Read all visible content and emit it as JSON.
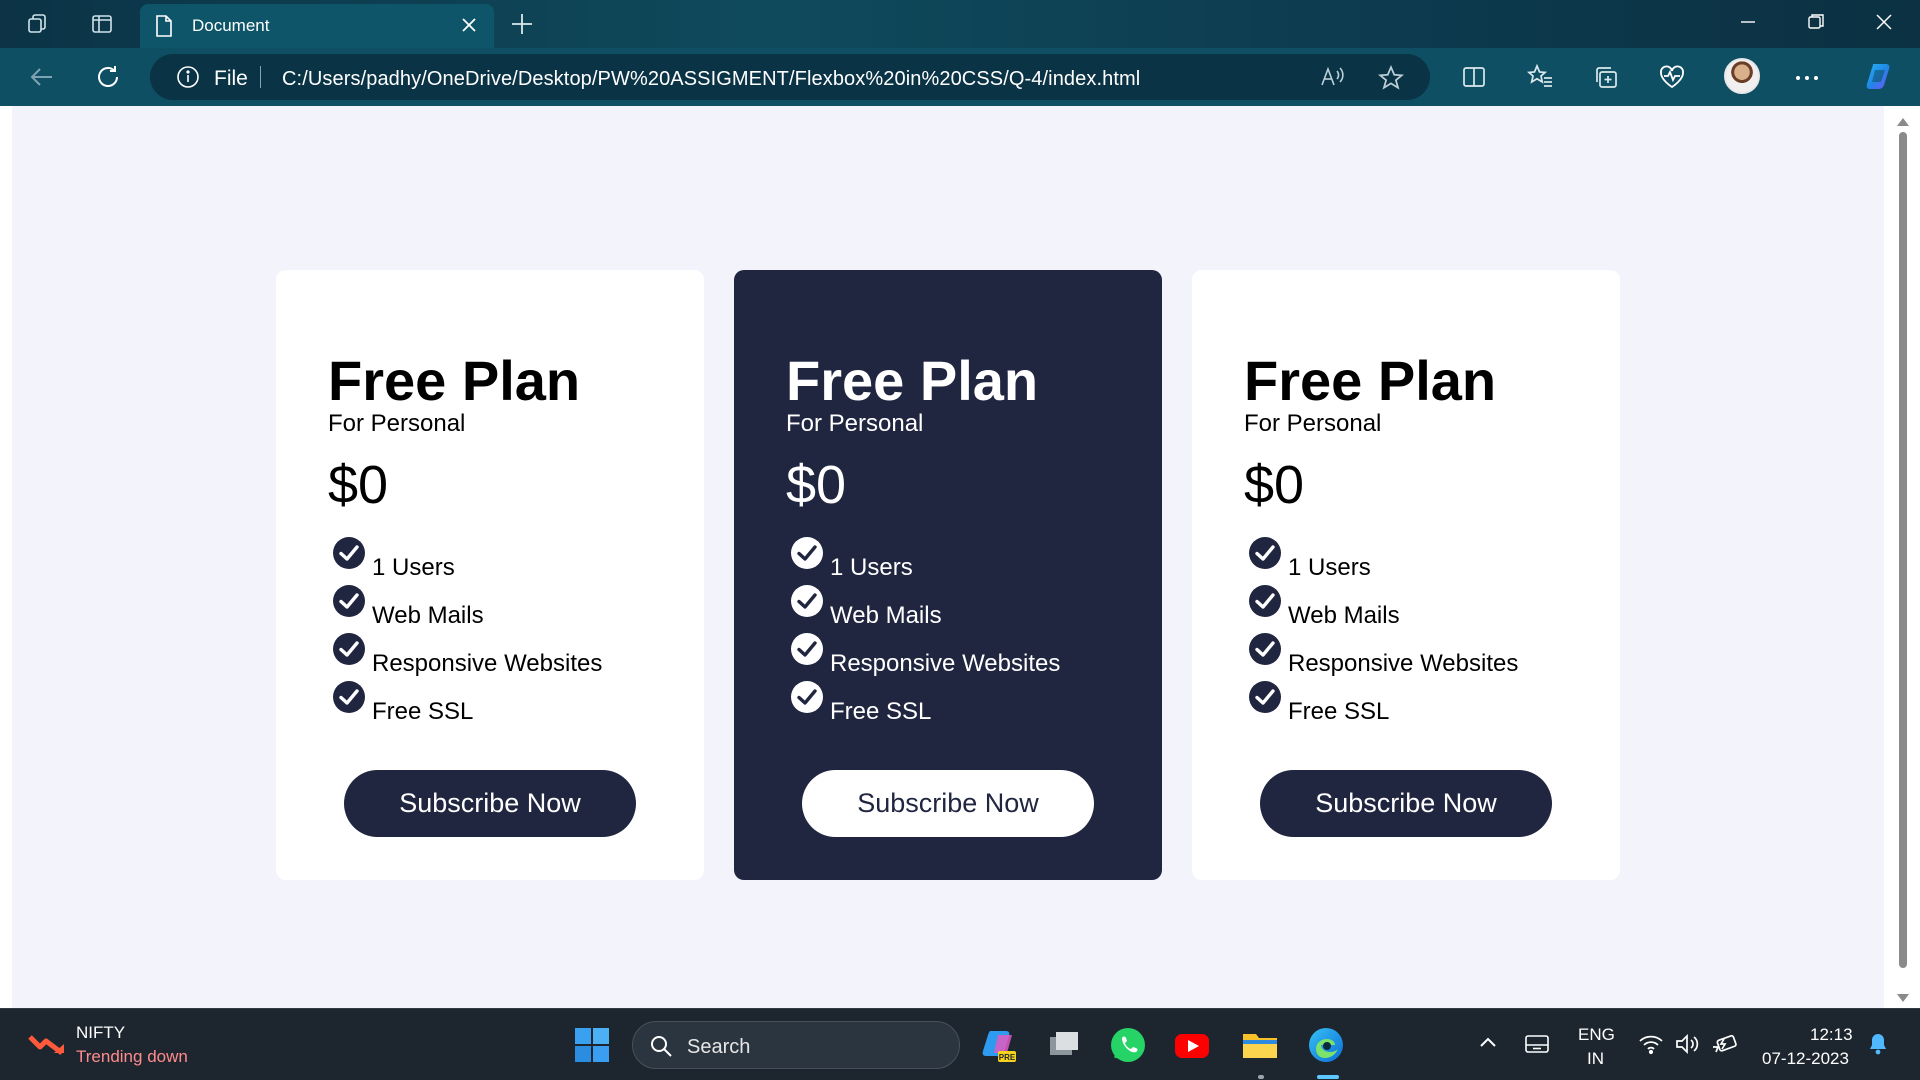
{
  "browser": {
    "tab_title": "Document",
    "address_prefix": "File",
    "url": "C:/Users/padhy/OneDrive/Desktop/PW%20ASSIGMENT/Flexbox%20in%20CSS/Q-4/index.html",
    "accent": "#0f4f63"
  },
  "page": {
    "background": "#f3f3fc",
    "cards": [
      {
        "title": "Free Plan",
        "subtitle": "For Personal",
        "price": "$0",
        "features": [
          "1 Users",
          "Web Mails",
          "Responsive Websites",
          "Free SSL"
        ],
        "button": "Subscribe Now",
        "theme": "light"
      },
      {
        "title": "Free Plan",
        "subtitle": "For Personal",
        "price": "$0",
        "features": [
          "1 Users",
          "Web Mails",
          "Responsive Websites",
          "Free SSL"
        ],
        "button": "Subscribe Now",
        "theme": "dark"
      },
      {
        "title": "Free Plan",
        "subtitle": "For Personal",
        "price": "$0",
        "features": [
          "1 Users",
          "Web Mails",
          "Responsive Websites",
          "Free SSL"
        ],
        "button": "Subscribe Now",
        "theme": "light"
      }
    ],
    "dark_color": "#212640"
  },
  "taskbar": {
    "widget_title": "NIFTY",
    "widget_status": "Trending down",
    "search_placeholder": "Search",
    "lang_line1": "ENG",
    "lang_line2": "IN",
    "time": "12:13",
    "date": "07-12-2023"
  }
}
